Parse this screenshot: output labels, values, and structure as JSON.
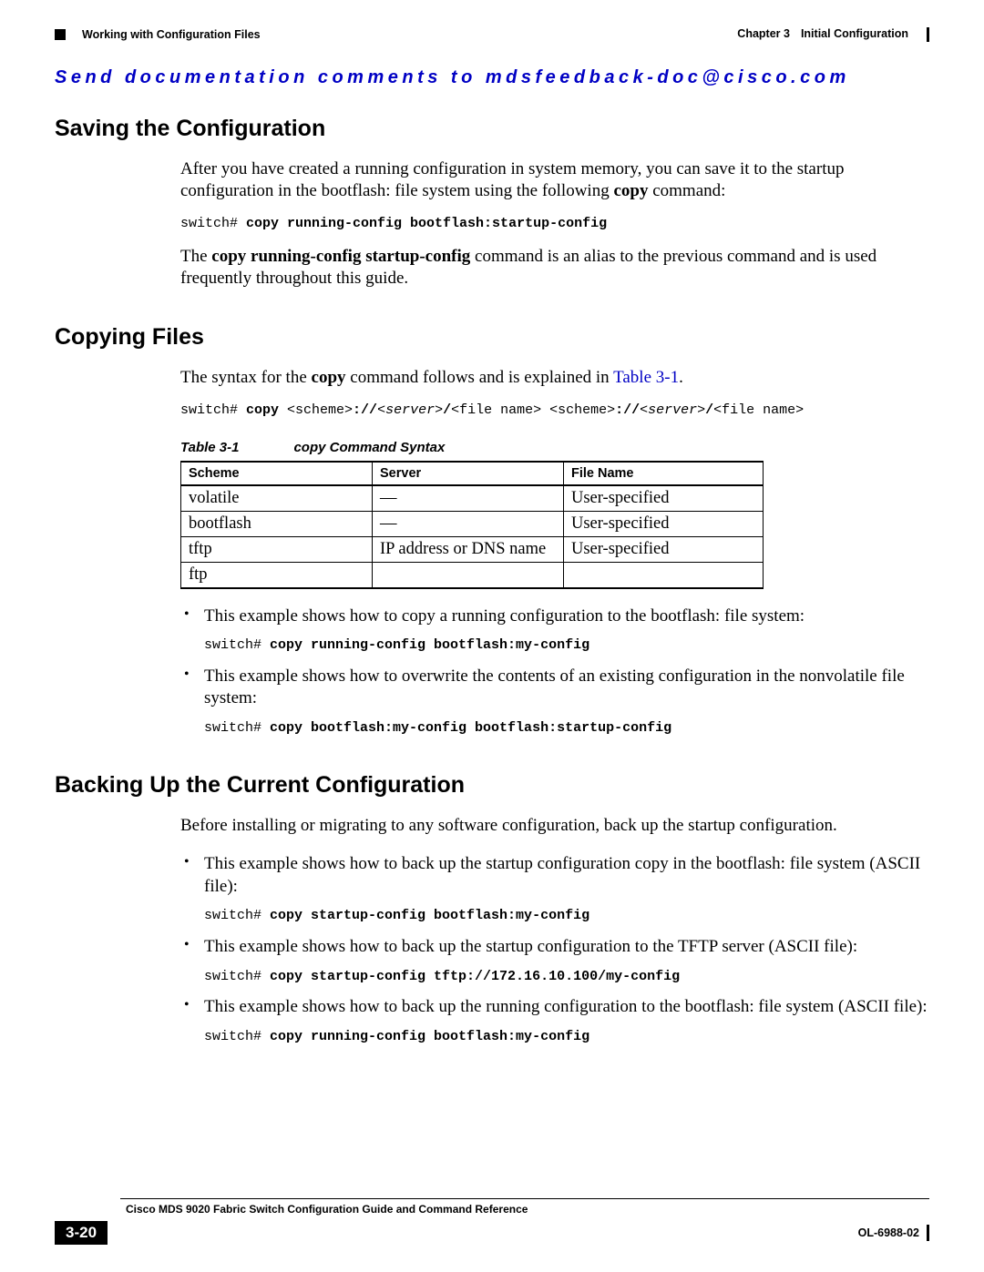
{
  "header": {
    "section_name": "Working with Configuration Files",
    "chapter_label": "Chapter 3",
    "chapter_title": "Initial Configuration"
  },
  "feedback": "Send documentation comments to mdsfeedback-doc@cisco.com",
  "s1": {
    "heading": "Saving the Configuration",
    "p1a": "After you have created a running configuration in system memory, you can save it to the startup configuration in the bootflash: file system using the following ",
    "p1_bold": "copy",
    "p1b": " command:",
    "cmd1_prompt": "switch# ",
    "cmd1_cmd": "copy running-config bootflash:startup-config",
    "p2a": "The ",
    "p2_bold": "copy running-config startup-config",
    "p2b": " command is an alias to the previous command and is used frequently throughout this guide."
  },
  "s2": {
    "heading": "Copying Files",
    "p1a": "The syntax for the ",
    "p1_bold": "copy",
    "p1b": " command follows and is explained in ",
    "p1_link": "Table 3-1",
    "p1c": ".",
    "cmd_prompt": "switch# ",
    "cmd_p1": "copy ",
    "cmd_p2": "<scheme>",
    "cmd_p3": "://",
    "cmd_p4": "<server>",
    "cmd_p5": "/",
    "cmd_p6": "<file name> <scheme>",
    "cmd_p7": "://",
    "cmd_p8": "<server>",
    "cmd_p9": "/",
    "cmd_p10": "<file name>",
    "table_caption_a": "Table 3-1",
    "table_caption_b": "copy Command Syntax",
    "th1": "Scheme",
    "th2": "Server",
    "th3": "File Name",
    "rows": [
      {
        "c1": "volatile",
        "c2": "—",
        "c3": "User-specified"
      },
      {
        "c1": "bootflash",
        "c2": "—",
        "c3": "User-specified"
      },
      {
        "c1": "tftp",
        "c2": "IP address or DNS name",
        "c3": "User-specified"
      },
      {
        "c1": "ftp",
        "c2": "",
        "c3": ""
      }
    ],
    "b1_text": "This example shows how to copy a running configuration to the bootflash: file system:",
    "b1_cmd_prompt": "switch# ",
    "b1_cmd": "copy running-config bootflash:my-config",
    "b2_text": "This example shows how to overwrite the contents of an existing configuration in the nonvolatile file system:",
    "b2_cmd_prompt": "switch# ",
    "b2_cmd": "copy bootflash:my-config bootflash:startup-config"
  },
  "s3": {
    "heading": "Backing Up the Current Configuration",
    "p1": "Before installing or migrating to any software configuration, back up the startup configuration.",
    "b1_text": "This example shows how to back up the startup configuration copy in the bootflash: file system (ASCII file):",
    "b1_cmd_prompt": "switch# ",
    "b1_cmd": "copy startup-config bootflash:my-config",
    "b2_text": "This example shows how to back up the startup configuration to the TFTP server (ASCII file):",
    "b2_cmd_prompt": "switch# ",
    "b2_cmd": "copy startup-config tftp://172.16.10.100/my-config",
    "b3_text": "This example shows how to back up the running configuration to the bootflash: file system (ASCII file):",
    "b3_cmd_prompt": "switch# ",
    "b3_cmd": "copy running-config bootflash:my-config"
  },
  "footer": {
    "book_title": "Cisco MDS 9020 Fabric Switch Configuration Guide and Command Reference",
    "page_number": "3-20",
    "doc_id": "OL-6988-02"
  }
}
